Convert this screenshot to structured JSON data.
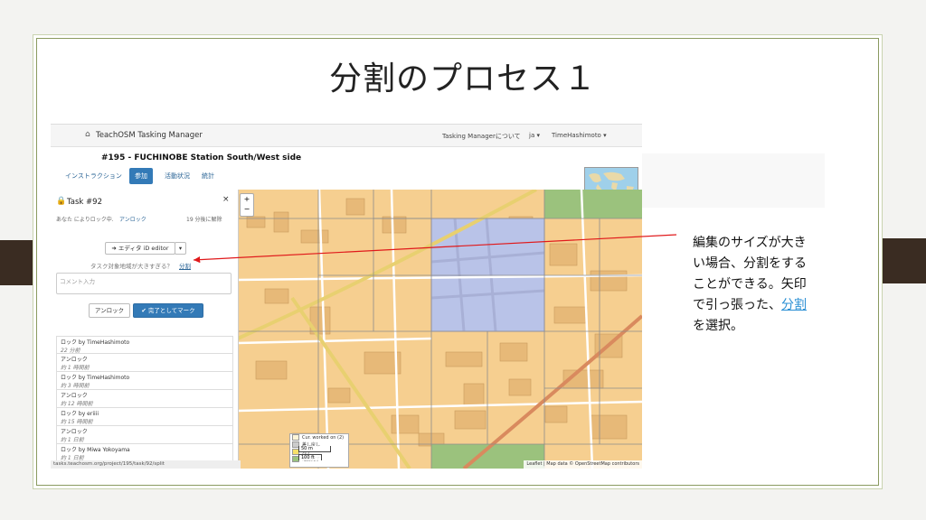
{
  "slide": {
    "title": "分割のプロセス１"
  },
  "navbar": {
    "brand": "TeachOSM Tasking Manager",
    "about": "Tasking Managerについて",
    "lang": "ja ▾",
    "user": "TimeHashimoto ▾"
  },
  "project": {
    "title": "#195 - FUCHINOBE Station South/West side",
    "tabs": [
      "インストラクション",
      "参加",
      "活動状況",
      "統計"
    ]
  },
  "task": {
    "title": "Task #92",
    "lock_info": "あなた によりロック中.",
    "unlock_link": "アンロック",
    "expires": "19 分後に解除",
    "editor_button": "➜ エディタ iD editor",
    "split_question": "タスク対象地域が大きすぎる？",
    "split_link": "分割",
    "comment_placeholder": "コメント入力",
    "unlock_button": "アンロック",
    "done_button": "✔ 完了としてマーク"
  },
  "history": [
    {
      "action": "ロック by TimeHashimoto",
      "time": "22 分前"
    },
    {
      "action": "アンロック",
      "time": "約 1 時間前"
    },
    {
      "action": "ロック by TimeHashimoto",
      "time": "約 3 時間前"
    },
    {
      "action": "アンロック",
      "time": "約 12 時間前"
    },
    {
      "action": "ロック by eriiii",
      "time": "約 15 時間前"
    },
    {
      "action": "アンロック",
      "time": "約 1 日前"
    },
    {
      "action": "ロック by Miwa Yokoyama",
      "time": "約 1 日前"
    }
  ],
  "status_url": "tasks.teachosm.org/project/195/task/92/split",
  "legend": [
    {
      "label": "Cur. worked on (2)",
      "color": "#fdf5d8"
    },
    {
      "label": "差し戻し",
      "color": "#cccccc"
    },
    {
      "label": "完了",
      "color": "#f7e06a"
    },
    {
      "label": "確認完了",
      "color": "#9bc27d"
    }
  ],
  "scale": {
    "m": "50 m",
    "ft": "100 ft"
  },
  "attribution": "Leaflet | Map data © OpenStreetMap contributors",
  "map_zoom": {
    "in": "+",
    "out": "−"
  },
  "note": {
    "text_before": "編集のサイズが大きい場合、分割をすることができる。矢印で引っ張った、",
    "link": "分割",
    "text_after": "を選択。"
  },
  "colors": {
    "accent": "#337ab7",
    "selected_task": "#b9c3e8",
    "done_task": "#9bc27d",
    "arrow": "#e0191b"
  }
}
